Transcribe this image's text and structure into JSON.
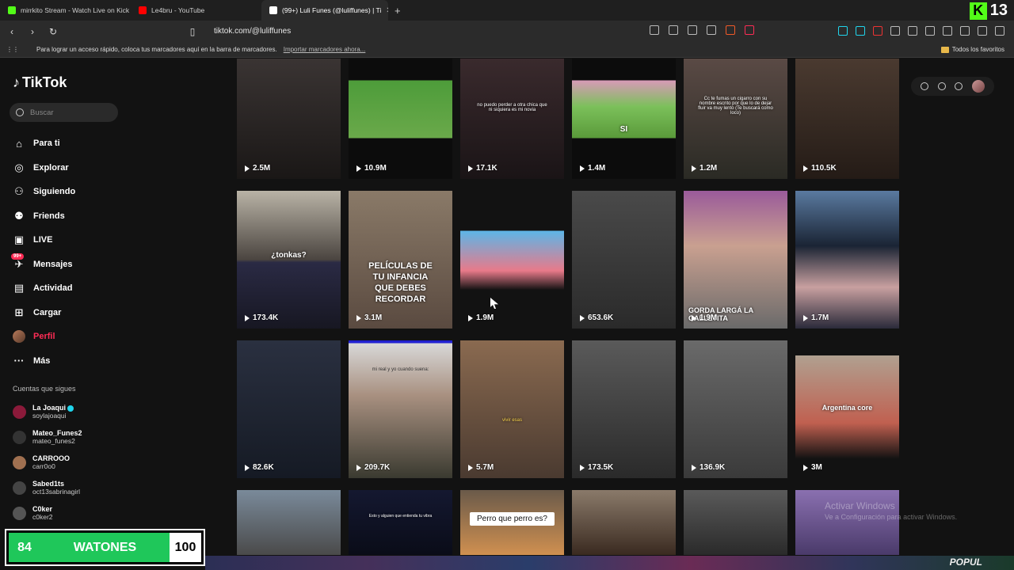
{
  "browser": {
    "tabs": [
      {
        "label": "mirrkito Stream - Watch Live on Kick",
        "color": "#53fc18"
      },
      {
        "label": "Le4bru - YouTube",
        "color": "#ff0000"
      },
      {
        "label": "(99+) Luli Funes (@luliffunes) | Ti",
        "color": "#ffffff"
      }
    ],
    "url": "tiktok.com/@luliffunes",
    "bookmarks_hint": "Para lograr un acceso rápido, coloca tus marcadores aquí en la barra de marcadores.",
    "bookmarks_link": "Importar marcadores ahora...",
    "favorites_label": "Todos los favoritos",
    "corner_logo": "K",
    "corner_number": "13"
  },
  "sidebar": {
    "brand": "TikTok",
    "search_placeholder": "Buscar",
    "nav": [
      {
        "label": "Para ti",
        "icon": "home-icon"
      },
      {
        "label": "Explorar",
        "icon": "compass-icon"
      },
      {
        "label": "Siguiendo",
        "icon": "following-icon"
      },
      {
        "label": "Friends",
        "icon": "friends-icon"
      },
      {
        "label": "LIVE",
        "icon": "live-icon"
      },
      {
        "label": "Mensajes",
        "icon": "messages-icon",
        "badge": "99+"
      },
      {
        "label": "Actividad",
        "icon": "activity-icon"
      },
      {
        "label": "Cargar",
        "icon": "upload-icon"
      },
      {
        "label": "Perfil",
        "icon": "profile-avatar"
      },
      {
        "label": "Más",
        "icon": "more-icon"
      }
    ],
    "following_title": "Cuentas que sigues",
    "following": [
      {
        "name": "La Joaqui",
        "user": "soylajoaqui",
        "color": "#8b1a3a"
      },
      {
        "name": "Mateo_Funes2",
        "user": "mateo_funes2",
        "color": "#333333"
      },
      {
        "name": "CARROOO",
        "user": "carr0o0",
        "color": "#a07050"
      },
      {
        "name": "Sabed1ts",
        "user": "oct13sabrinagirl",
        "color": "#444444"
      },
      {
        "name": "C0ker",
        "user": "c0ker2",
        "color": "#555555"
      }
    ]
  },
  "overlay": {
    "left": "84",
    "label": "WATONES",
    "right": "100"
  },
  "grid": {
    "rows": [
      [
        {
          "views": "2.5M",
          "caption": ""
        },
        {
          "views": "10.9M",
          "caption": ""
        },
        {
          "views": "17.1K",
          "caption": "no puedo perder a otra chica que ni siquiera es mi novia"
        },
        {
          "views": "1.4M",
          "caption": "SI"
        },
        {
          "views": "1.2M",
          "caption": "Cc te fumas un cigarro con su nombre escrito por que lo de dejar fluir va muy lento (Te buscará como loco)"
        },
        {
          "views": "110.5K",
          "caption": ""
        }
      ],
      [
        {
          "views": "173.4K",
          "caption": "¿tonkas?"
        },
        {
          "views": "3.1M",
          "caption": "PELÍCULAS DE TU INFANCIA QUE DEBES RECORDAR"
        },
        {
          "views": "1.9M",
          "caption": ""
        },
        {
          "views": "653.6K",
          "caption": ""
        },
        {
          "views": "1.9M",
          "caption": "GORDA LARGÁ LA GALLETITA"
        },
        {
          "views": "1.7M",
          "caption": ""
        }
      ],
      [
        {
          "views": "82.6K",
          "caption": ""
        },
        {
          "views": "209.7K",
          "caption": "mi real y yo cuando suena:"
        },
        {
          "views": "5.7M",
          "caption": "vivir esas"
        },
        {
          "views": "173.5K",
          "caption": ""
        },
        {
          "views": "136.9K",
          "caption": ""
        },
        {
          "views": "3M",
          "caption": "Argentina core"
        }
      ],
      [
        {
          "views": "",
          "caption": ""
        },
        {
          "views": "",
          "caption": "Esto y alguien que entienda tu vibra"
        },
        {
          "views": "",
          "caption": "Perro que perro es?"
        },
        {
          "views": "",
          "caption": ""
        },
        {
          "views": "",
          "caption": ""
        },
        {
          "views": "",
          "caption": ""
        }
      ]
    ]
  },
  "windows_watermark": "Activar Windows",
  "windows_watermark_sub": "Ve a Configuración para activar Windows.",
  "taskbar_text": "POPUL"
}
